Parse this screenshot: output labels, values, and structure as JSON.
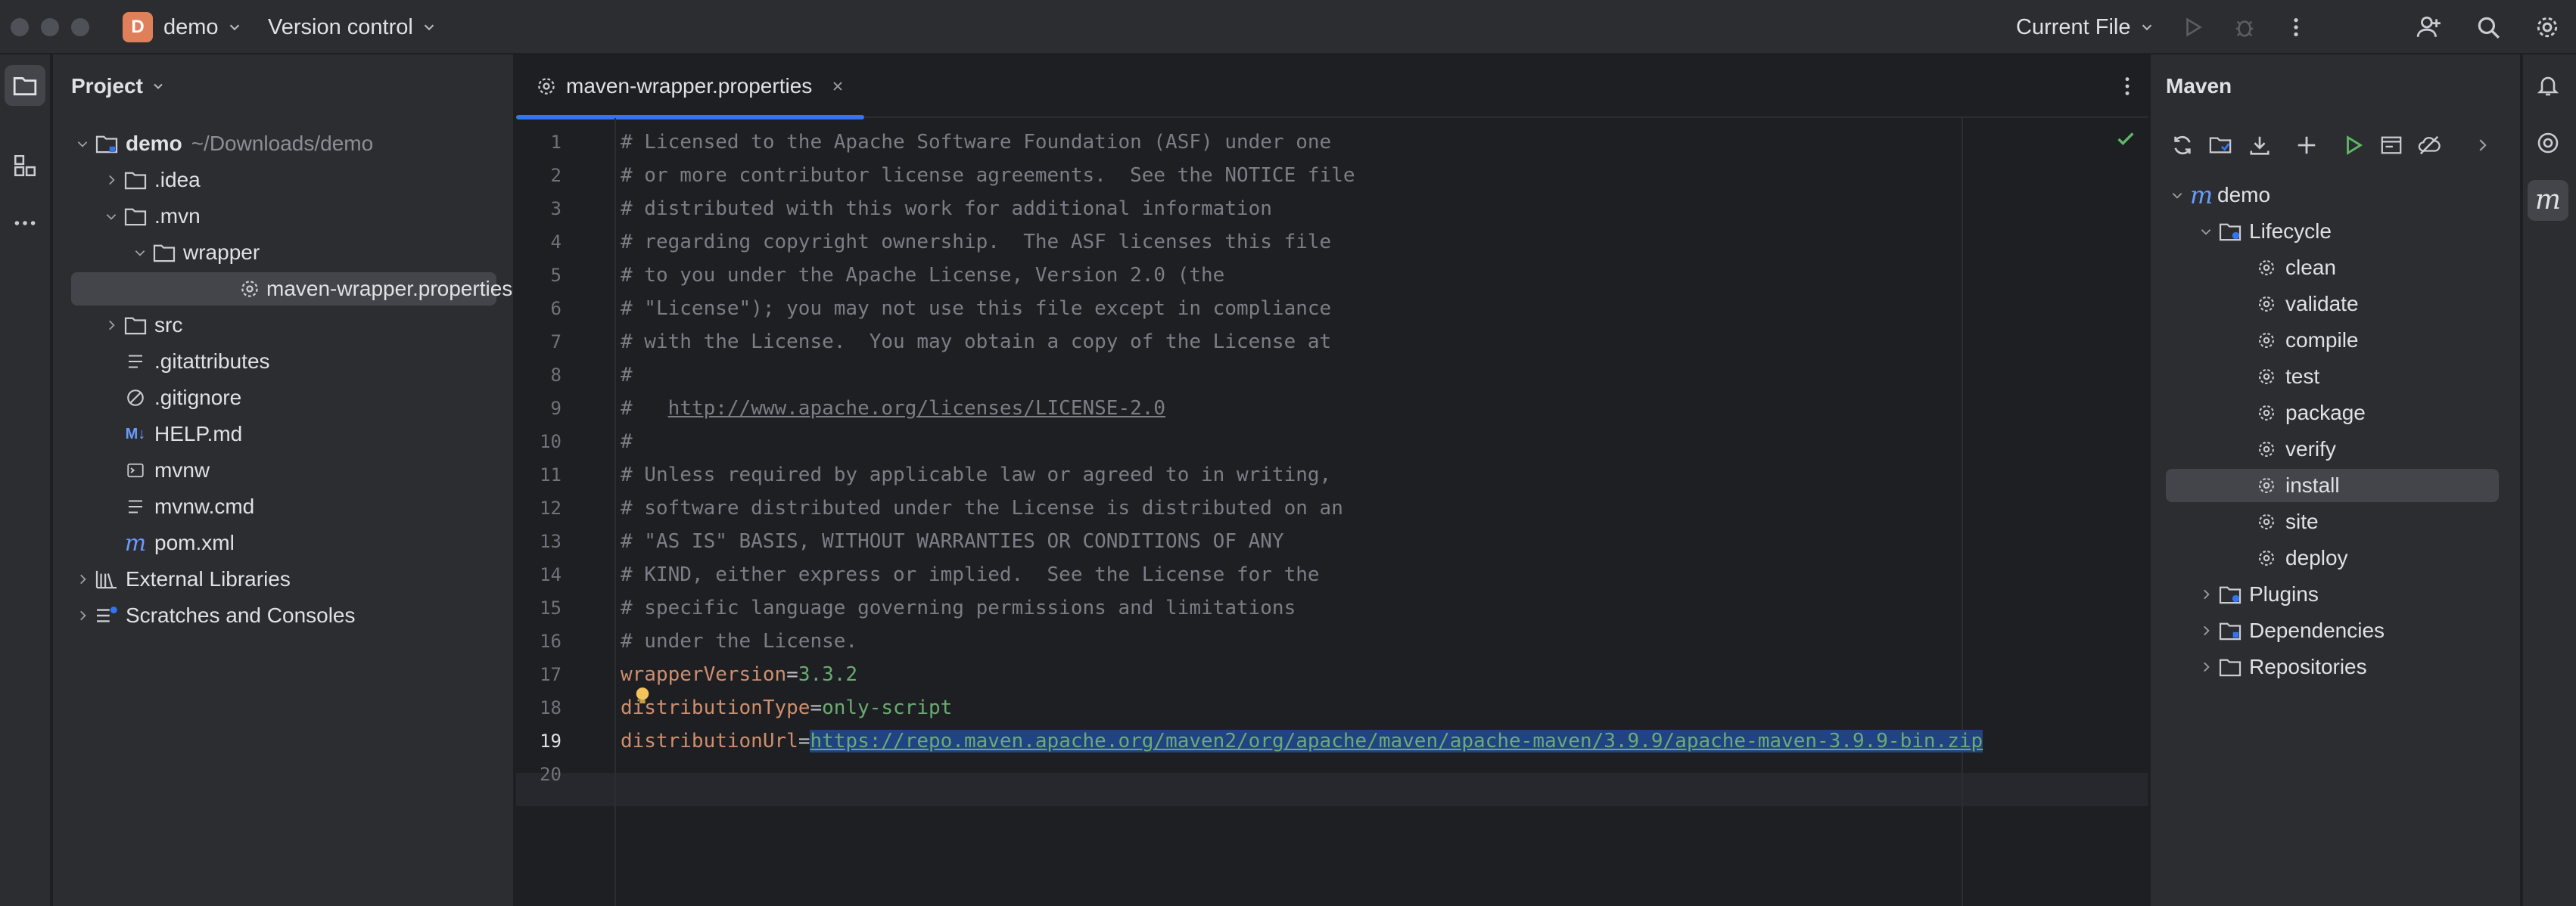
{
  "titlebar": {
    "project_badge": "D",
    "project_name": "demo",
    "vcs_label": "Version control",
    "run_config": "Current File"
  },
  "project_panel": {
    "title": "Project",
    "root_name": "demo",
    "root_path": "~/Downloads/demo",
    "items": {
      "idea": ".idea",
      "mvn": ".mvn",
      "wrapper": "wrapper",
      "wrapper_props": "maven-wrapper.properties",
      "src": "src",
      "gitattributes": ".gitattributes",
      "gitignore": ".gitignore",
      "help": "HELP.md",
      "mvnw": "mvnw",
      "mvnw_cmd": "mvnw.cmd",
      "pom": "pom.xml",
      "external_libraries": "External Libraries",
      "scratches": "Scratches and Consoles"
    },
    "md_badge": "M↓"
  },
  "editor": {
    "tab_label": "maven-wrapper.properties",
    "line_numbers": [
      "1",
      "2",
      "3",
      "4",
      "5",
      "6",
      "7",
      "8",
      "9",
      "10",
      "11",
      "12",
      "13",
      "14",
      "15",
      "16",
      "17",
      "18",
      "19",
      "20"
    ],
    "comments": [
      "# Licensed to the Apache Software Foundation (ASF) under one",
      "# or more contributor license agreements.  See the NOTICE file",
      "# distributed with this work for additional information",
      "# regarding copyright ownership.  The ASF licenses this file",
      "# to you under the Apache License, Version 2.0 (the",
      "# \"License\"); you may not use this file except in compliance",
      "# with the License.  You may obtain a copy of the License at",
      "#",
      "#",
      "#",
      "# Unless required by applicable law or agreed to in writing,",
      "# software distributed under the License is distributed on an",
      "# \"AS IS\" BASIS, WITHOUT WARRANTIES OR CONDITIONS OF ANY",
      "# KIND, either express or implied.  See the License for the",
      "# specific language governing permissions and limitations",
      "# under the License."
    ],
    "license_url": "http://www.apache.org/licenses/LICENSE-2.0",
    "props": {
      "k1": "wrapperVersion",
      "v1": "3.3.2",
      "k2": "distributionType",
      "v2": "only-script",
      "k3": "distributionUrl",
      "v3": "https://repo.maven.apache.org/maven2/org/apache/maven/apache-maven/3.9.9/apache-maven-3.9.9-bin.zip",
      "eq": "="
    }
  },
  "maven_panel": {
    "title": "Maven",
    "root": "demo",
    "lifecycle": "Lifecycle",
    "phases": [
      "clean",
      "validate",
      "compile",
      "test",
      "package",
      "verify",
      "install",
      "site",
      "deploy"
    ],
    "plugins": "Plugins",
    "dependencies": "Dependencies",
    "repositories": "Repositories"
  },
  "colors": {
    "accent": "#3574f0",
    "badge": "#e0805a",
    "string_green": "#6aab73",
    "key_orange": "#cf8e6d"
  }
}
